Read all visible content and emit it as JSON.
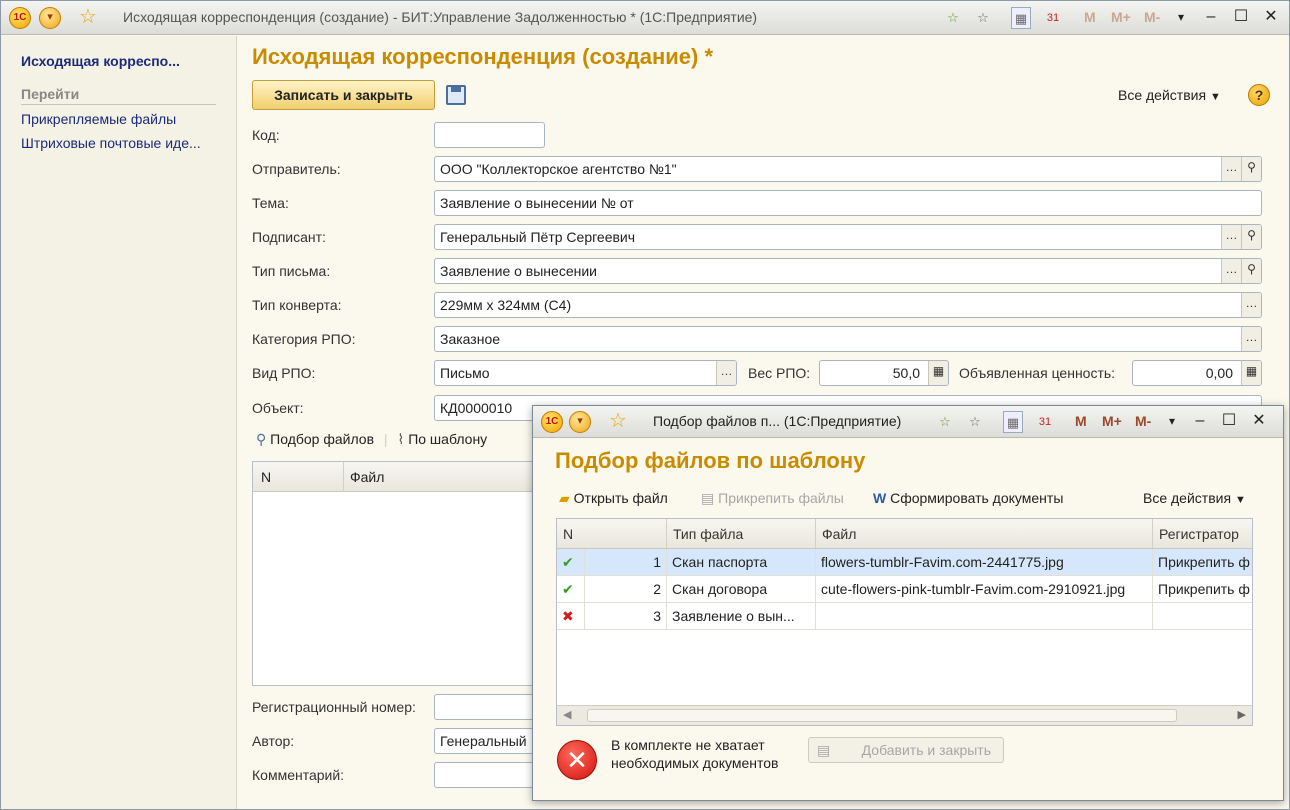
{
  "window": {
    "title": "Исходящая корреспонденция (создание) - БИТ:Управление Задолженностью * (1С:Предприятие)",
    "m_buttons": [
      "M",
      "M+",
      "M-"
    ]
  },
  "left_panel": {
    "title": "Исходящая корреспо...",
    "go_label": "Перейти",
    "links": [
      "Прикрепляемые файлы",
      "Штриховые почтовые иде..."
    ]
  },
  "form": {
    "title": "Исходящая корреспонденция (создание) *",
    "save_close_label": "Записать и закрыть",
    "all_actions_label": "Все действия",
    "help_label": "?",
    "fields": {
      "code": {
        "label": "Код:",
        "value": ""
      },
      "sender": {
        "label": "Отправитель:",
        "value": "ООО \"Коллекторское агентство №1\""
      },
      "topic": {
        "label": "Тема:",
        "value": "Заявление о вынесении №  от"
      },
      "signer": {
        "label": "Подписант:",
        "value": "Генеральный Пётр Сергеевич"
      },
      "letter_type": {
        "label": "Тип письма:",
        "value": "Заявление о вынесении"
      },
      "envelope_type": {
        "label": "Тип конверта:",
        "value": "229мм х 324мм (С4)"
      },
      "rpo_category": {
        "label": "Категория РПО:",
        "value": "Заказное"
      },
      "rpo_kind": {
        "label": "Вид РПО:",
        "value": "Письмо"
      },
      "rpo_weight": {
        "label": "Вес РПО:",
        "value": "50,0"
      },
      "declared_value": {
        "label": "Объявленная ценность:",
        "value": "0,00"
      },
      "object": {
        "label": "Объект:",
        "value": "КД0000010"
      },
      "reg_number": {
        "label": "Регистрационный номер:",
        "value": ""
      },
      "author": {
        "label": "Автор:",
        "value": "Генеральный"
      },
      "comment": {
        "label": "Комментарий:",
        "value": ""
      }
    },
    "files_toolbar": {
      "pick_files": "Подбор файлов",
      "by_template": "По шаблону"
    },
    "files_table": {
      "columns": [
        "N",
        "Файл"
      ]
    }
  },
  "dialog": {
    "title": "Подбор файлов п...  (1С:Предприятие)",
    "heading": "Подбор файлов по шаблону",
    "toolbar": {
      "open_file": "Открыть файл",
      "attach_files": "Прикрепить файлы",
      "generate_docs": "Сформировать документы",
      "all_actions": "Все действия"
    },
    "m_buttons": [
      "M",
      "M+",
      "M-"
    ],
    "table": {
      "columns": [
        "N",
        "Тип файла",
        "Файл",
        "Регистратор"
      ],
      "rows": [
        {
          "status": "ok",
          "n": "1",
          "type": "Скан паспорта",
          "file": "flowers-tumblr-Favim.com-2441775.jpg",
          "registrar": "Прикрепить ф"
        },
        {
          "status": "ok",
          "n": "2",
          "type": "Скан договора",
          "file": "cute-flowers-pink-tumblr-Favim.com-2910921.jpg",
          "registrar": "Прикрепить ф"
        },
        {
          "status": "missing",
          "n": "3",
          "type": "Заявление о вын...",
          "file": "",
          "registrar": ""
        }
      ]
    },
    "error_text": "В комплекте не хватает необходимых документов",
    "add_close_label": "Добавить и закрыть"
  }
}
